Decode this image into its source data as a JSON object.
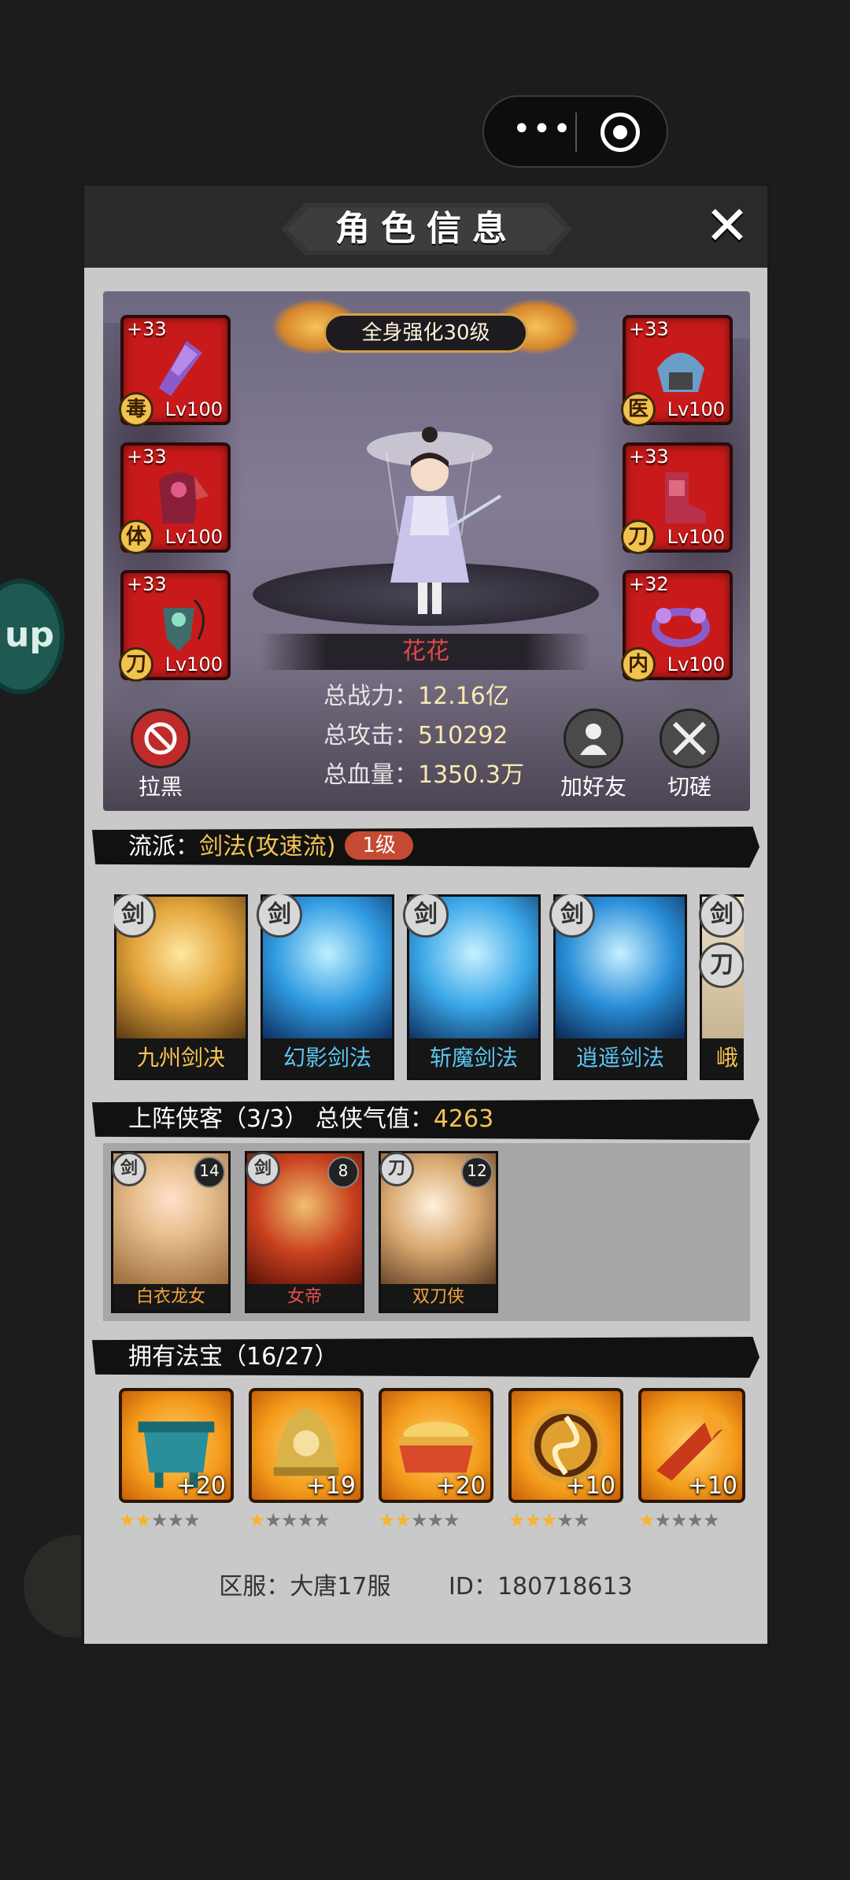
{
  "window": {
    "title": "角色信息",
    "close_icon": "close-icon",
    "more_icon": "more-dots-icon",
    "target_icon": "target-icon"
  },
  "side_badge": {
    "text": "up"
  },
  "hero": {
    "full_body": "全身强化30级",
    "name": "花花",
    "stats": [
      {
        "label": "总战力：",
        "value": "12.16亿"
      },
      {
        "label": "总攻击：",
        "value": "510292"
      },
      {
        "label": "总血量：",
        "value": "1350.3万"
      }
    ],
    "equipment_left": [
      {
        "plus": "+33",
        "level": "Lv100",
        "tag": "毒",
        "icon": "gauntlet-icon"
      },
      {
        "plus": "+33",
        "level": "Lv100",
        "tag": "体",
        "icon": "armor-icon"
      },
      {
        "plus": "+33",
        "level": "Lv100",
        "tag": "刀",
        "icon": "amulet-icon"
      }
    ],
    "equipment_right": [
      {
        "plus": "+33",
        "level": "Lv100",
        "tag": "医",
        "icon": "helmet-icon"
      },
      {
        "plus": "+33",
        "level": "Lv100",
        "tag": "刀",
        "icon": "boots-icon"
      },
      {
        "plus": "+32",
        "level": "Lv100",
        "tag": "内",
        "icon": "ring-icon"
      }
    ],
    "actions": {
      "block": "拉黑",
      "add_friend": "加好友",
      "spar": "切磋"
    }
  },
  "school": {
    "label": "流派：",
    "value": "剑法(攻速流)",
    "level": "1级"
  },
  "skills": [
    {
      "name": "九州剑决",
      "weapon": "剑",
      "color": "#f5c453"
    },
    {
      "name": "幻影剑法",
      "weapon": "剑",
      "color": "#5cc8f5"
    },
    {
      "name": "斩魔剑法",
      "weapon": "剑",
      "color": "#5cc8f5"
    },
    {
      "name": "逍遥剑法",
      "weapon": "剑",
      "color": "#5cc8f5"
    },
    {
      "name": "峨",
      "weapon": "剑",
      "weapon2": "刀",
      "color": "#f5c453"
    }
  ],
  "team": {
    "label": "上阵侠客（3/3）",
    "qi_label": "总侠气值：",
    "qi_value": "4263",
    "heroes": [
      {
        "name": "白衣龙女",
        "weapon": "剑",
        "stars": "14",
        "color": "#f5a53a"
      },
      {
        "name": "女帝",
        "weapon": "剑",
        "stars": "8",
        "color": "#e85050"
      },
      {
        "name": "双刀侠",
        "weapon": "刀",
        "stars": "12",
        "color": "#f5a53a"
      }
    ]
  },
  "treasures": {
    "label": "拥有法宝（16/27）",
    "items": [
      {
        "count": "+20",
        "stars": 2,
        "icon": "cauldron-icon"
      },
      {
        "count": "+19",
        "stars": 1,
        "icon": "bell-icon"
      },
      {
        "count": "+20",
        "stars": 2,
        "icon": "gold-bowl-icon"
      },
      {
        "count": "+10",
        "stars": 3,
        "icon": "swirl-disc-icon"
      },
      {
        "count": "+10",
        "stars": 1,
        "icon": "flame-blade-icon"
      }
    ],
    "max_stars": 5
  },
  "footer": {
    "server_label": "区服：大唐17服",
    "id_label": "ID：180718613"
  }
}
